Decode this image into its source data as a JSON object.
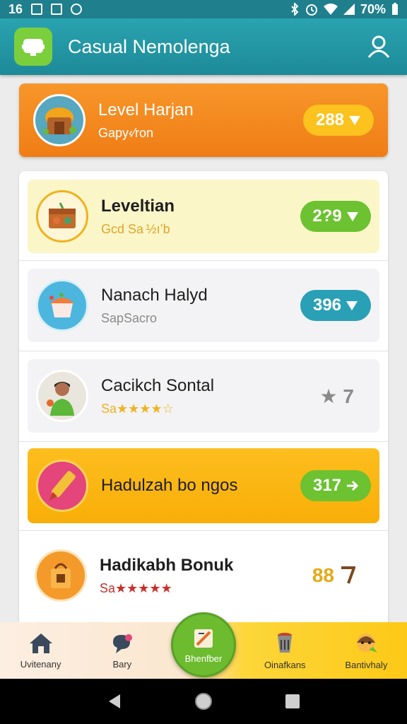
{
  "status_bar": {
    "time": "16",
    "battery": "70%",
    "icons": [
      "image-icon",
      "app-icon",
      "sync-icon",
      "bluetooth-icon",
      "alarm-icon",
      "wifi-icon",
      "signal-icon",
      "battery-icon"
    ]
  },
  "app_bar": {
    "title": "Casual Nemolenga",
    "logo_icon": "app-logo-icon",
    "profile_icon": "profile-icon"
  },
  "featured": {
    "title": "Level Harjan",
    "subtitle": "Gapy‹⁄ron",
    "score": "288",
    "score_icon": "arrow-check-icon"
  },
  "rows": [
    {
      "title": "Leveltian",
      "subtitle": "Gcd Sa ½ı’b",
      "score": "2?9",
      "score_icon": "arrow-check-icon",
      "icon": "box-icon",
      "style": "yellow"
    },
    {
      "title": "Nanach Halyd",
      "subtitle": "SapSacro",
      "score": "396",
      "score_icon": "arrow-check-icon",
      "icon": "cupcake-icon",
      "style": "gray"
    },
    {
      "title": "Cacikch Sontal",
      "subtitle": "Sa★★★★☆",
      "score": "★ 7",
      "icon": "person-avatar-icon",
      "style": "gray"
    },
    {
      "title": "Hadulzah bo ngos",
      "subtitle": "",
      "score": "317",
      "score_icon": "arrow-icon",
      "icon": "pencil-ball-icon",
      "style": "orange"
    },
    {
      "title": "Hadikabh Bonuk",
      "subtitle": "Sa★★★★★",
      "score": "88",
      "score_icon": "flag-icon",
      "icon": "bag-icon",
      "style": "white"
    }
  ],
  "bottom_nav": [
    {
      "label": "Uvitenany",
      "icon": "house-icon"
    },
    {
      "label": "Bary",
      "icon": "chat-heart-icon"
    },
    {
      "label": "Bhenfber",
      "icon": "scroll-icon",
      "center": true
    },
    {
      "label": "Oinafkans",
      "icon": "bucket-icon"
    },
    {
      "label": "Bantivhaly",
      "icon": "face-hand-icon"
    }
  ],
  "colors": {
    "app_bar": "#1d8a98",
    "featured": "#f38a1e",
    "green_pill": "#6cc230",
    "teal_pill": "#2aa0b6",
    "gold_score": "#e4a817",
    "fab": "#6dbb2f"
  }
}
